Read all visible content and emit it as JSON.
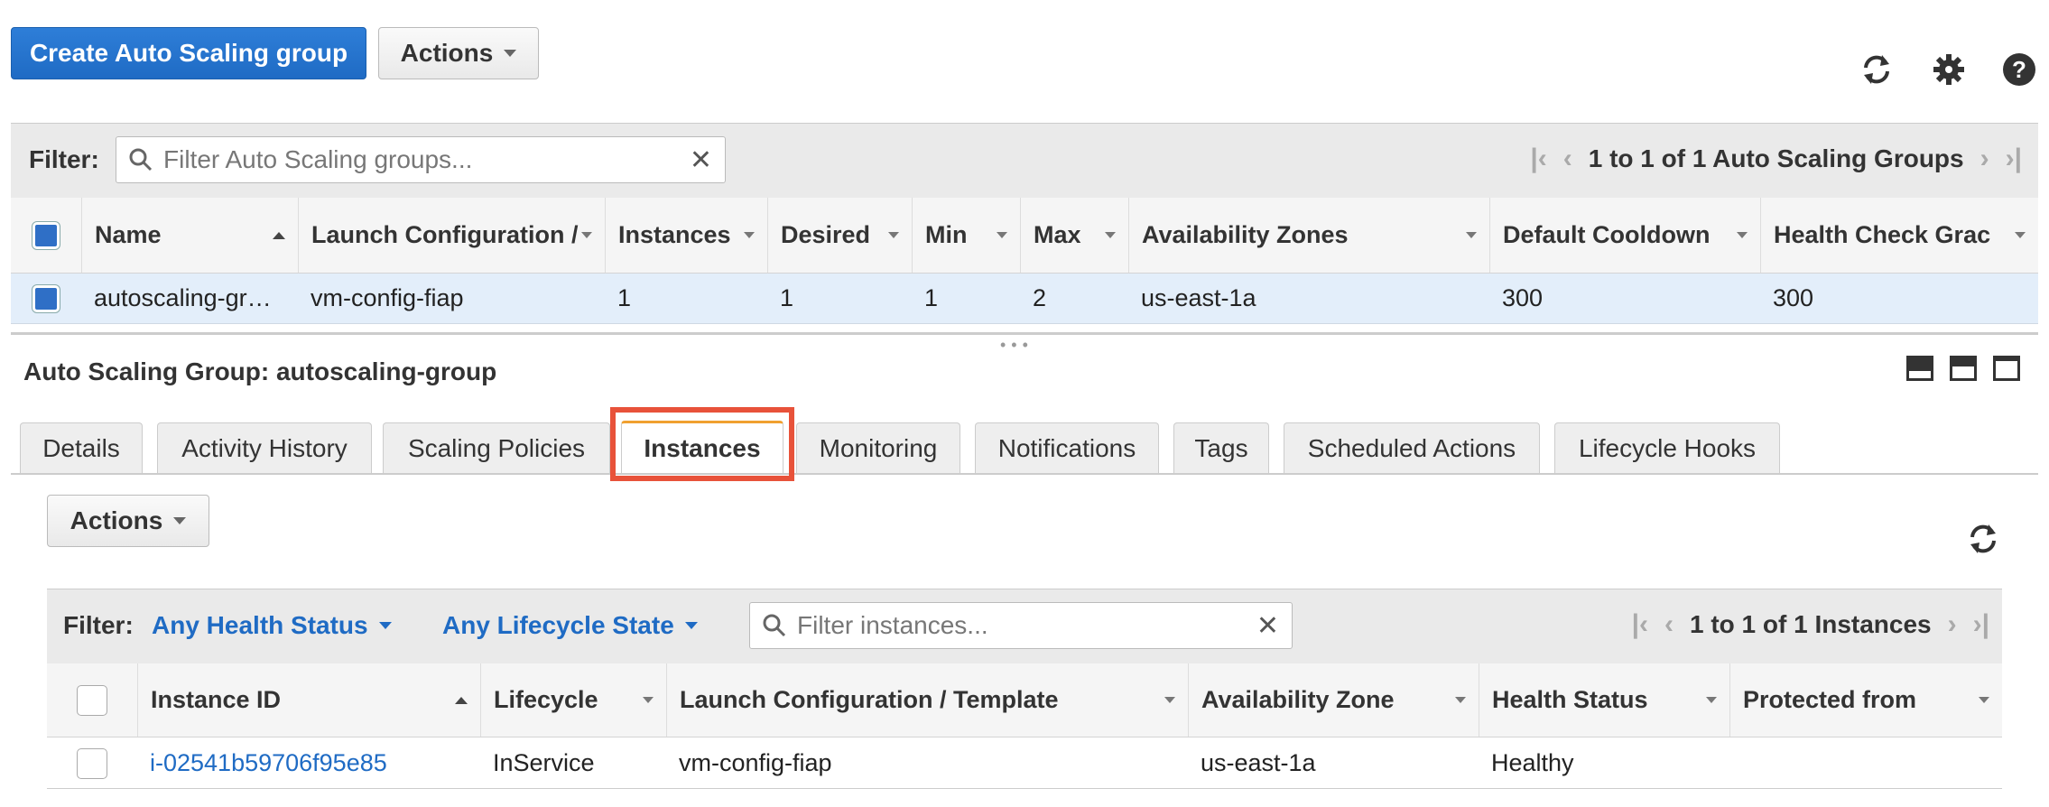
{
  "toolbar": {
    "create_label": "Create Auto Scaling group",
    "actions_label": "Actions",
    "icons": [
      "refresh-icon",
      "gear-icon",
      "help-icon"
    ]
  },
  "groups_filter": {
    "label": "Filter:",
    "placeholder": "Filter Auto Scaling groups...",
    "pager_text": "1 to 1 of 1 Auto Scaling Groups"
  },
  "groups_table": {
    "columns": [
      "Name",
      "Launch Configuration /",
      "Instances",
      "Desired",
      "Min",
      "Max",
      "Availability Zones",
      "Default Cooldown",
      "Health Check Grac"
    ],
    "rows": [
      [
        "autoscaling-gr…",
        "vm-config-fiap",
        "1",
        "1",
        "1",
        "2",
        "us-east-1a",
        "300",
        "300"
      ]
    ]
  },
  "detail": {
    "title": "Auto Scaling Group: autoscaling-group",
    "tabs": [
      "Details",
      "Activity History",
      "Scaling Policies",
      "Instances",
      "Monitoring",
      "Notifications",
      "Tags",
      "Scheduled Actions",
      "Lifecycle Hooks"
    ],
    "active_tab": "Instances",
    "highlight_color": "#e8523a"
  },
  "instances": {
    "actions_label": "Actions",
    "filter_label": "Filter:",
    "health_filter": "Any Health Status",
    "lifecycle_filter": "Any Lifecycle State",
    "placeholder": "Filter instances...",
    "pager_text": "1 to 1 of 1 Instances",
    "columns": [
      "Instance ID",
      "Lifecycle",
      "Launch Configuration / Template",
      "Availability Zone",
      "Health Status",
      "Protected from"
    ],
    "rows": [
      [
        "i-02541b59706f95e85",
        "InService",
        "vm-config-fiap",
        "us-east-1a",
        "Healthy",
        ""
      ]
    ]
  },
  "colors": {
    "primary": "#1f6bc4",
    "tab_accent": "#f0a030",
    "highlight": "#e8523a"
  }
}
